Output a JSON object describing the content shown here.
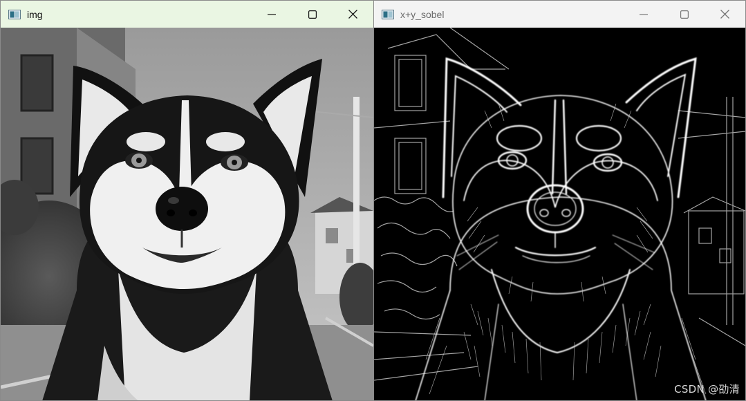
{
  "windows": [
    {
      "title": "img",
      "icon": "opencv-window-icon",
      "controls": {
        "minimize_icon": "minimize-icon",
        "maximize_icon": "maximize-icon",
        "close_icon": "close-icon"
      }
    },
    {
      "title": "x+y_sobel",
      "icon": "opencv-window-icon",
      "controls": {
        "minimize_icon": "minimize-icon",
        "maximize_icon": "maximize-icon",
        "close_icon": "close-icon"
      }
    }
  ],
  "watermark": "CSDN @劭清",
  "colors": {
    "active_titlebar": "#eaf6e3",
    "inactive_titlebar": "#f3f3f3",
    "edge_background": "#000000",
    "edge_lines": "#ffffff"
  }
}
